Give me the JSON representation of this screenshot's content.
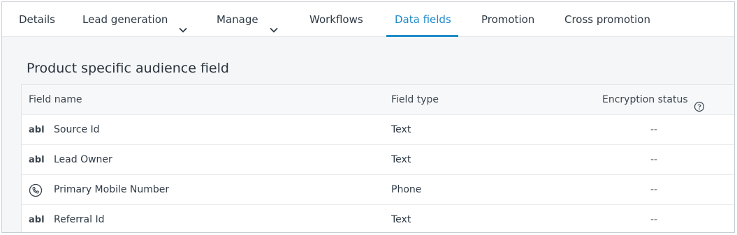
{
  "tabs": [
    {
      "label": "Details"
    },
    {
      "label": "Lead generation"
    },
    {
      "label": "Manage"
    },
    {
      "label": "Workflows"
    },
    {
      "label": "Data fields"
    },
    {
      "label": "Promotion"
    },
    {
      "label": "Cross promotion"
    }
  ],
  "active_tab": "Data fields",
  "section": {
    "title": "Product specific audience field"
  },
  "table": {
    "columns": {
      "name": "Field name",
      "type": "Field type",
      "encryption": "Encryption status"
    },
    "rows": [
      {
        "icon": "abl",
        "icon_name": "text-type-icon",
        "name": "Source Id",
        "type": "Text",
        "encryption": "--"
      },
      {
        "icon": "abl",
        "icon_name": "text-type-icon",
        "name": "Lead Owner",
        "type": "Text",
        "encryption": "--"
      },
      {
        "icon": "",
        "icon_name": "phone-icon",
        "name": "Primary Mobile Number",
        "type": "Phone",
        "encryption": "--"
      },
      {
        "icon": "abl",
        "icon_name": "text-type-icon",
        "name": "Referral Id",
        "type": "Text",
        "encryption": "--"
      }
    ]
  },
  "colors": {
    "accent": "#1f8ac9",
    "page_bg": "#f5f6f7",
    "text": "#2f3a45"
  }
}
